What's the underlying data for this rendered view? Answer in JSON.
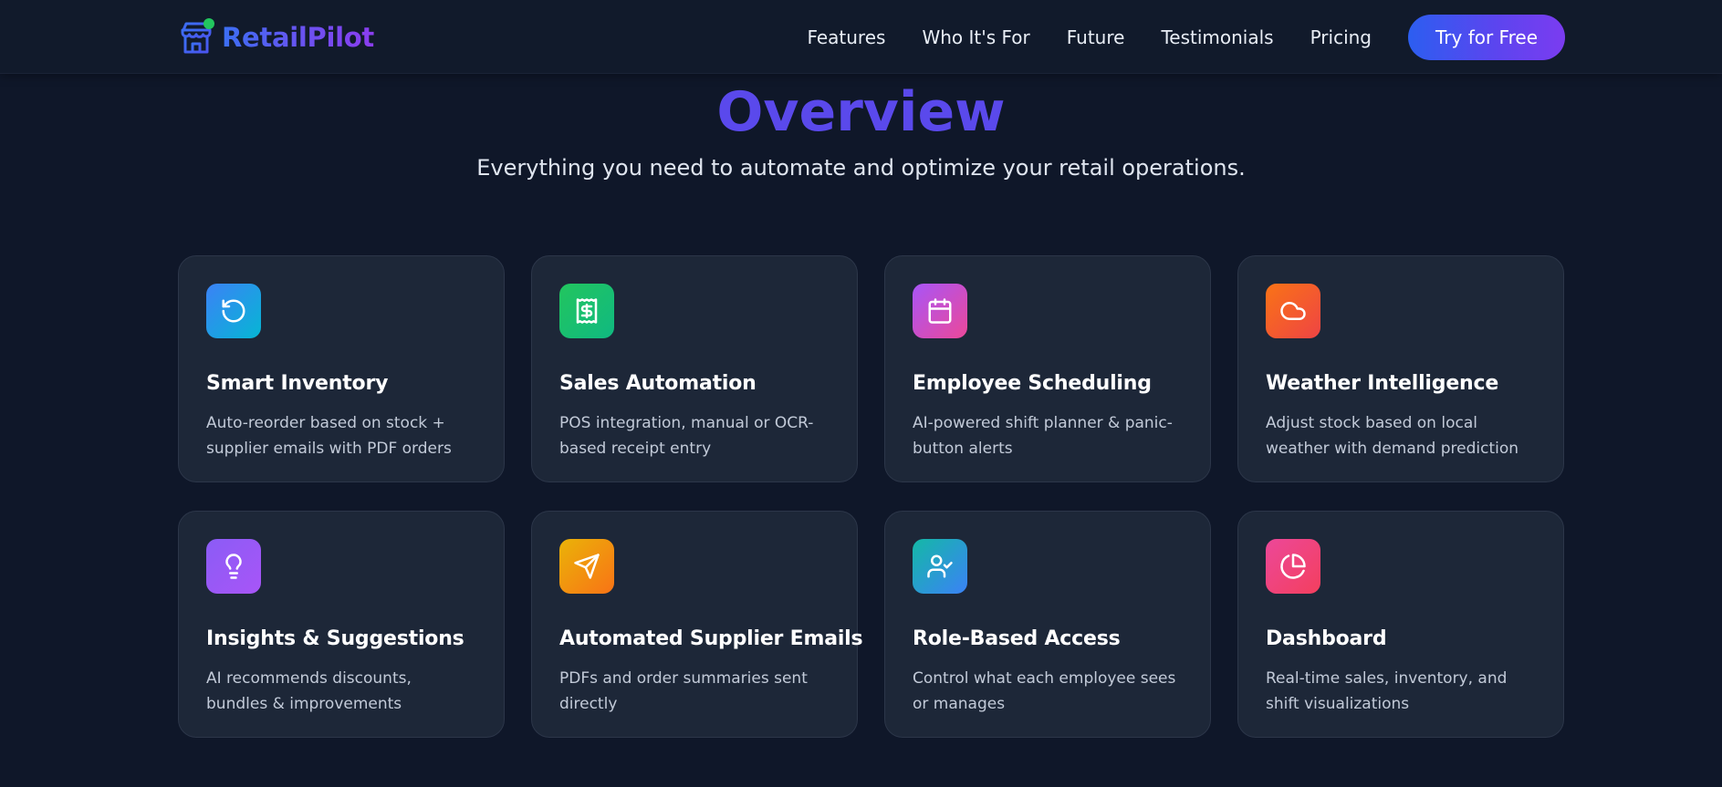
{
  "brand": {
    "name": "RetailPilot",
    "icon": "storefront-icon"
  },
  "nav": {
    "links": [
      "Features",
      "Who It's For",
      "Future",
      "Testimonials",
      "Pricing"
    ],
    "cta_label": "Try for Free"
  },
  "hero": {
    "title": "Overview",
    "subtitle": "Everything you need to automate and optimize your retail operations."
  },
  "features": [
    {
      "title": "Smart Inventory",
      "description": "Auto-reorder based on stock + supplier emails with PDF orders",
      "icon": "refresh-icon",
      "colors": [
        "#3b82f6",
        "#06b6d4"
      ]
    },
    {
      "title": "Sales Automation",
      "description": "POS integration, manual or OCR-based receipt entry",
      "icon": "receipt-icon",
      "colors": [
        "#22c55e",
        "#10b981"
      ]
    },
    {
      "title": "Employee Scheduling",
      "description": "AI-powered shift planner & panic-button alerts",
      "icon": "calendar-icon",
      "colors": [
        "#a855f7",
        "#ec4899"
      ]
    },
    {
      "title": "Weather Intelligence",
      "description": "Adjust stock based on local weather with demand prediction",
      "icon": "cloud-icon",
      "colors": [
        "#f97316",
        "#ef4444"
      ]
    },
    {
      "title": "Insights & Suggestions",
      "description": "AI recommends discounts, bundles & improvements",
      "icon": "lightbulb-icon",
      "colors": [
        "#8b5cf6",
        "#a855f7"
      ]
    },
    {
      "title": "Automated Supplier Emails",
      "description": "PDFs and order summaries sent directly",
      "icon": "send-icon",
      "colors": [
        "#eab308",
        "#f97316"
      ]
    },
    {
      "title": "Role-Based Access",
      "description": "Control what each employee sees or manages",
      "icon": "user-check-icon",
      "colors": [
        "#14b8a6",
        "#3b82f6"
      ]
    },
    {
      "title": "Dashboard",
      "description": "Real-time sales, inventory, and shift visualizations",
      "icon": "pie-chart-icon",
      "colors": [
        "#ec4899",
        "#f43f5e"
      ]
    }
  ]
}
